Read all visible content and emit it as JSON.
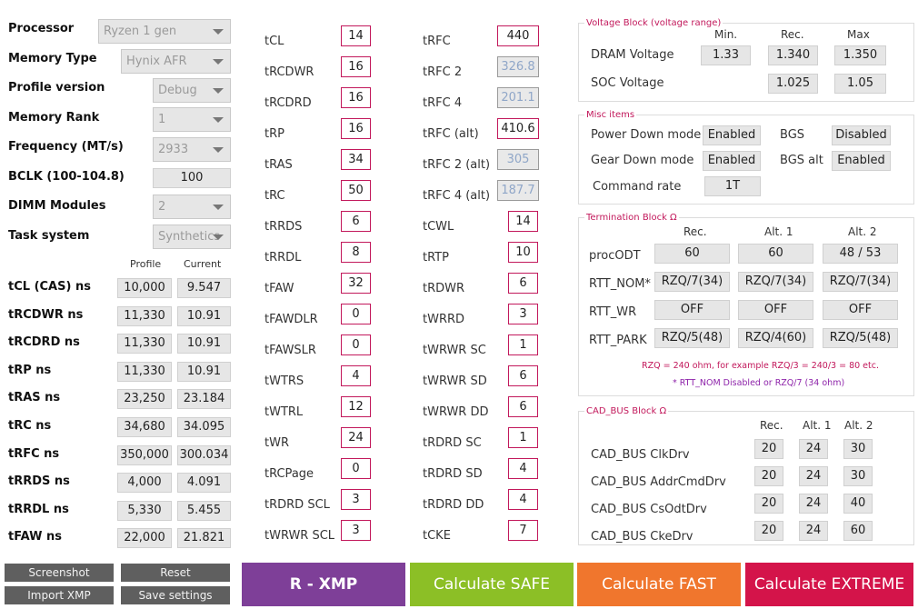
{
  "settings": [
    {
      "label": "Processor",
      "value": "Ryzen 1 gen"
    },
    {
      "label": "Memory Type",
      "value": "Hynix AFR"
    },
    {
      "label": "Profile version",
      "value": "Debug"
    },
    {
      "label": "Memory Rank",
      "value": "1"
    },
    {
      "label": "Frequency (MT/s)",
      "value": "2933"
    },
    {
      "label": "BCLK (100-104.8)",
      "value": "100"
    },
    {
      "label": "DIMM Modules",
      "value": "2"
    },
    {
      "label": "Task system",
      "value": "Synthetics"
    }
  ],
  "ns_table": {
    "profile_header": "Profile",
    "current_header": "Current",
    "rows": [
      {
        "label": "tCL (CAS) ns",
        "profile": "10,000",
        "current": "9.547"
      },
      {
        "label": "tRCDWR ns",
        "profile": "11,330",
        "current": "10.91"
      },
      {
        "label": "tRCDRD ns",
        "profile": "11,330",
        "current": "10.91"
      },
      {
        "label": "tRP ns",
        "profile": "11,330",
        "current": "10.91"
      },
      {
        "label": "tRAS ns",
        "profile": "23,250",
        "current": "23.184"
      },
      {
        "label": "tRC ns",
        "profile": "34,680",
        "current": "34.095"
      },
      {
        "label": "tRFC ns",
        "profile": "350,000",
        "current": "300.034"
      },
      {
        "label": "tRRDS ns",
        "profile": "4,000",
        "current": "4.091"
      },
      {
        "label": "tRRDL ns",
        "profile": "5,330",
        "current": "5.455"
      },
      {
        "label": "tFAW ns",
        "profile": "22,000",
        "current": "21.821"
      }
    ]
  },
  "timings_col1": [
    {
      "label": "tCL",
      "value": "14"
    },
    {
      "label": "tRCDWR",
      "value": "16"
    },
    {
      "label": "tRCDRD",
      "value": "16"
    },
    {
      "label": "tRP",
      "value": "16"
    },
    {
      "label": "tRAS",
      "value": "34"
    },
    {
      "label": "tRC",
      "value": "50"
    },
    {
      "label": "tRRDS",
      "value": "6"
    },
    {
      "label": "tRRDL",
      "value": "8"
    },
    {
      "label": "tFAW",
      "value": "32"
    },
    {
      "label": "tFAWDLR",
      "value": "0"
    },
    {
      "label": "tFAWSLR",
      "value": "0"
    },
    {
      "label": "tWTRS",
      "value": "4"
    },
    {
      "label": "tWTRL",
      "value": "12"
    },
    {
      "label": "tWR",
      "value": "24"
    },
    {
      "label": "tRCPage",
      "value": "0"
    },
    {
      "label": "tRDRD SCL",
      "value": "3"
    },
    {
      "label": "tWRWR SCL",
      "value": "3"
    }
  ],
  "timings_col2": [
    {
      "label": "tRFC",
      "value": "440"
    },
    {
      "label": "tRFC 2",
      "value": "326.8"
    },
    {
      "label": "tRFC 4",
      "value": "201.1"
    },
    {
      "label": "tRFC (alt)",
      "value": "410.6"
    },
    {
      "label": "tRFC 2 (alt)",
      "value": "305"
    },
    {
      "label": "tRFC 4 (alt)",
      "value": "187.7"
    },
    {
      "label": "tCWL",
      "value": "14"
    },
    {
      "label": "tRTP",
      "value": "10"
    },
    {
      "label": "tRDWR",
      "value": "6"
    },
    {
      "label": "tWRRD",
      "value": "3"
    },
    {
      "label": "tWRWR SC",
      "value": "1"
    },
    {
      "label": "tWRWR SD",
      "value": "6"
    },
    {
      "label": "tWRWR DD",
      "value": "6"
    },
    {
      "label": "tRDRD SC",
      "value": "1"
    },
    {
      "label": "tRDRD SD",
      "value": "4"
    },
    {
      "label": "tRDRD DD",
      "value": "4"
    },
    {
      "label": "tCKE",
      "value": "7"
    }
  ],
  "voltage": {
    "title": "Voltage Block (voltage range)",
    "headers": [
      "Min.",
      "Rec.",
      "Max"
    ],
    "rows": [
      {
        "label": "DRAM Voltage",
        "min": "1.33",
        "rec": "1.340",
        "max": "1.350"
      },
      {
        "label": "SOC Voltage",
        "rec": "1.025",
        "max": "1.05"
      }
    ]
  },
  "misc": {
    "title": "Misc items",
    "power_down_label": "Power Down mode",
    "power_down_value": "Enabled",
    "bgs_label": "BGS",
    "bgs_value": "Disabled",
    "gear_down_label": "Gear Down mode",
    "gear_down_value": "Enabled",
    "bgs_alt_label": "BGS alt",
    "bgs_alt_value": "Enabled",
    "command_rate_label": "Command rate",
    "command_rate_value": "1T"
  },
  "termination": {
    "title": "Termination Block Ω",
    "headers": [
      "Rec.",
      "Alt. 1",
      "Alt. 2"
    ],
    "rows": [
      {
        "label": "procODT",
        "values": [
          "60",
          "60",
          "48 / 53"
        ]
      },
      {
        "label": "RTT_NOM*",
        "values": [
          "RZQ/7(34)",
          "RZQ/7(34)",
          "RZQ/7(34)"
        ]
      },
      {
        "label": "RTT_WR",
        "values": [
          "OFF",
          "OFF",
          "OFF"
        ]
      },
      {
        "label": "RTT_PARK",
        "values": [
          "RZQ/5(48)",
          "RZQ/4(60)",
          "RZQ/5(48)"
        ]
      }
    ],
    "note1": "RZQ = 240 ohm, for example RZQ/3 = 240/3 = 80 etc.",
    "note2": "* RTT_NOM Disabled or RZQ/7 (34 ohm)"
  },
  "cad_bus": {
    "title": "CAD_BUS Block Ω",
    "headers": [
      "Rec.",
      "Alt. 1",
      "Alt. 2"
    ],
    "rows": [
      {
        "label": "CAD_BUS ClkDrv",
        "values": [
          "20",
          "24",
          "30"
        ]
      },
      {
        "label": "CAD_BUS AddrCmdDrv",
        "values": [
          "20",
          "24",
          "30"
        ]
      },
      {
        "label": "CAD_BUS CsOdtDrv",
        "values": [
          "20",
          "24",
          "40"
        ]
      },
      {
        "label": "CAD_BUS CkeDrv",
        "values": [
          "20",
          "24",
          "60"
        ]
      }
    ]
  },
  "buttons": {
    "screenshot": "Screenshot",
    "reset": "Reset",
    "import_xmp": "Import XMP",
    "save_settings": "Save settings",
    "r_xmp": "R - XMP",
    "calc_safe": "Calculate SAFE",
    "calc_fast": "Calculate FAST",
    "calc_extreme": "Calculate EXTREME"
  },
  "colors": {
    "accent": "#c2185b",
    "r_xmp": "#7e3f98",
    "safe": "#8cbf26",
    "fast": "#f0762d",
    "extreme": "#d4144a"
  }
}
